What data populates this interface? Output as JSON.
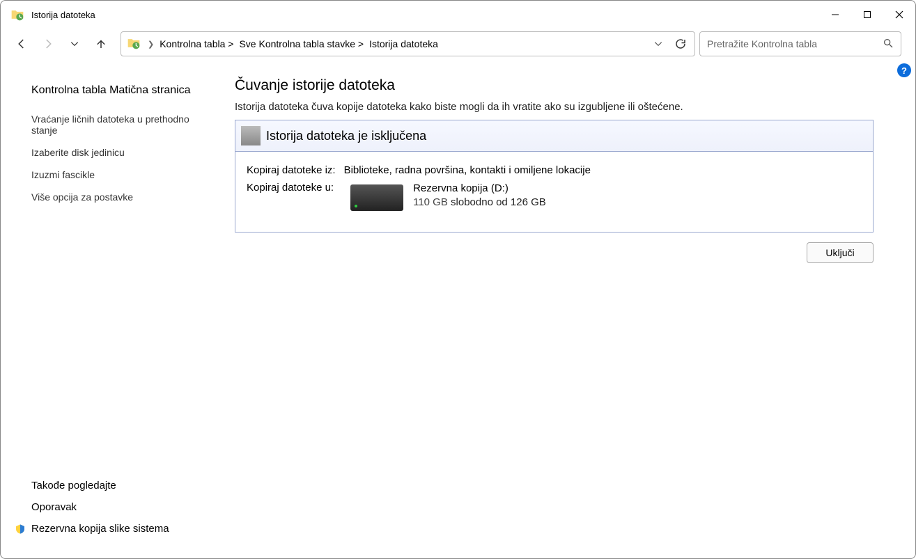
{
  "window": {
    "title": "Istorija datoteka"
  },
  "breadcrumb": {
    "items": [
      "Kontrolna tabla >",
      "Sve Kontrolna tabla stavke >",
      "Istorija datoteka"
    ]
  },
  "search": {
    "placeholder": "Pretražite Kontrolna tabla"
  },
  "sidebar": {
    "home": "Kontrolna tabla Matična stranica",
    "links": [
      "Vraćanje ličnih datoteka u prethodno stanje",
      "Izaberite disk jedinicu",
      "Izuzmi fascikle",
      "Više opcija za postavke"
    ],
    "seealso_title": "Takođe pogledajte",
    "seealso": [
      "Oporavak",
      "Rezervna kopija slike sistema"
    ]
  },
  "main": {
    "heading": "Čuvanje istorije datoteka",
    "subtitle": "Istorija datoteka čuva kopije datoteka kako biste mogli da ih vratite ako su izgubljene ili oštećene.",
    "status": "Istorija datoteka je isključena",
    "copy_from_label": "Kopiraj datoteke iz:",
    "copy_from_value": "Biblioteke, radna površina, kontakti i omiljene lokacije",
    "copy_to_label": "Kopiraj datoteke u:",
    "drive_name": "Rezervna kopija (D:)",
    "drive_free": "110 GB",
    "drive_free_suffix": " slobodno od 126 GB",
    "turn_on": "Uključi"
  },
  "help": "?"
}
